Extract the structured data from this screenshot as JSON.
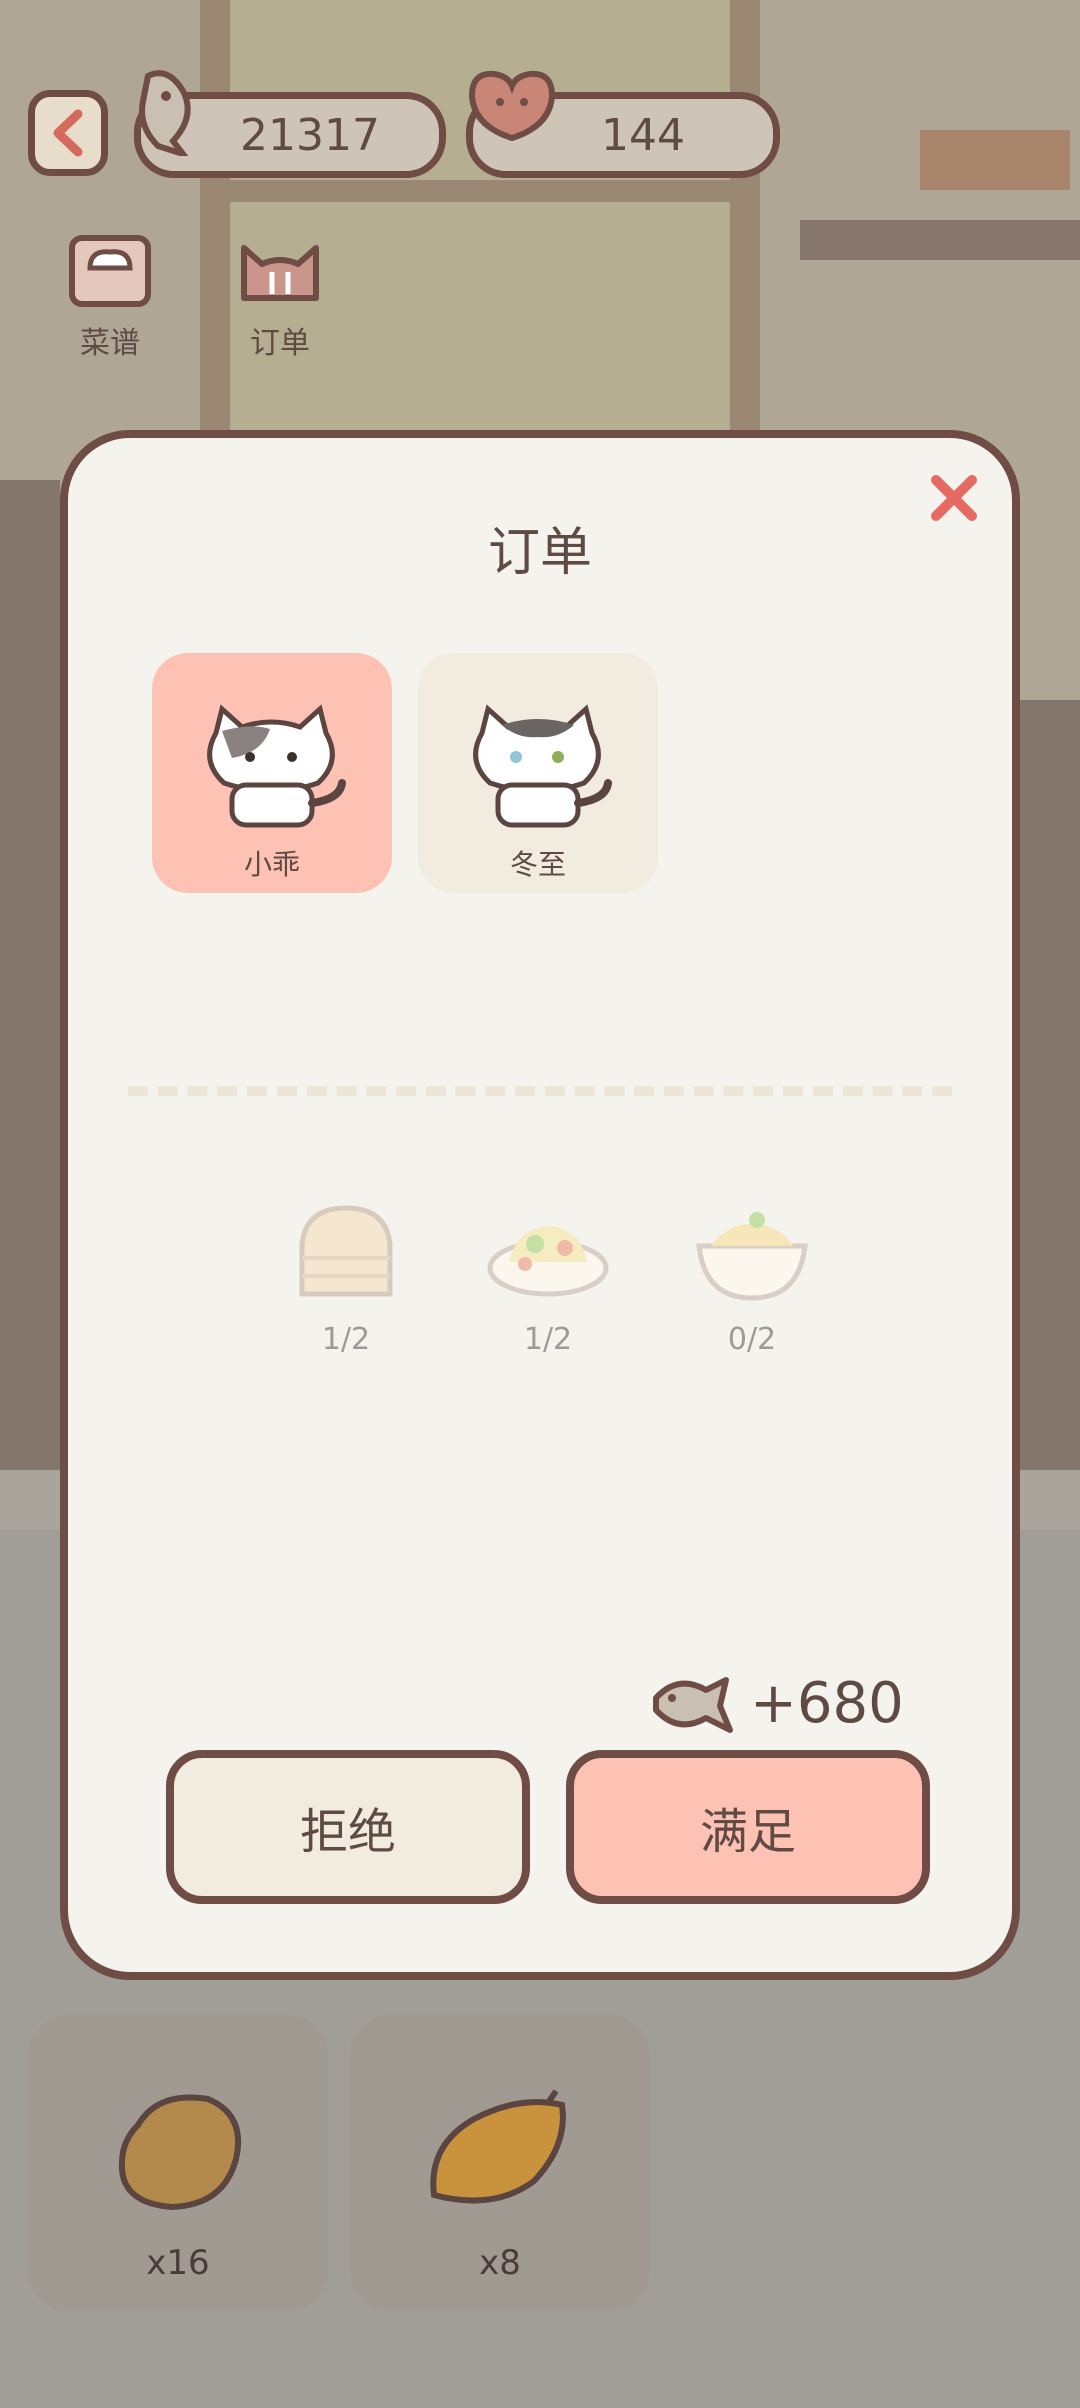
{
  "hud": {
    "fish_count": "21317",
    "heart_count": "144"
  },
  "top_tabs": [
    {
      "label": "菜谱"
    },
    {
      "label": "订单"
    }
  ],
  "modal": {
    "title": "订单",
    "customers": [
      {
        "name": "小乖",
        "selected": true
      },
      {
        "name": "冬至",
        "selected": false
      }
    ],
    "dishes": [
      {
        "icon": "steamed-bun-icon",
        "progress": "1/2"
      },
      {
        "icon": "fried-rice-icon",
        "progress": "1/2"
      },
      {
        "icon": "mashed-potato-bowl-icon",
        "progress": "0/2"
      }
    ],
    "reward": "+680",
    "reject_label": "拒绝",
    "fulfill_label": "满足"
  },
  "ingredients": [
    {
      "icon": "potato-icon",
      "count": "x16"
    },
    {
      "icon": "mango-icon",
      "count": "x8"
    }
  ],
  "colors": {
    "accent_pink": "#fec2b4",
    "card_cream": "#f1ebe0",
    "outline_brown": "#6f4c44",
    "close_red": "#e76a62"
  }
}
